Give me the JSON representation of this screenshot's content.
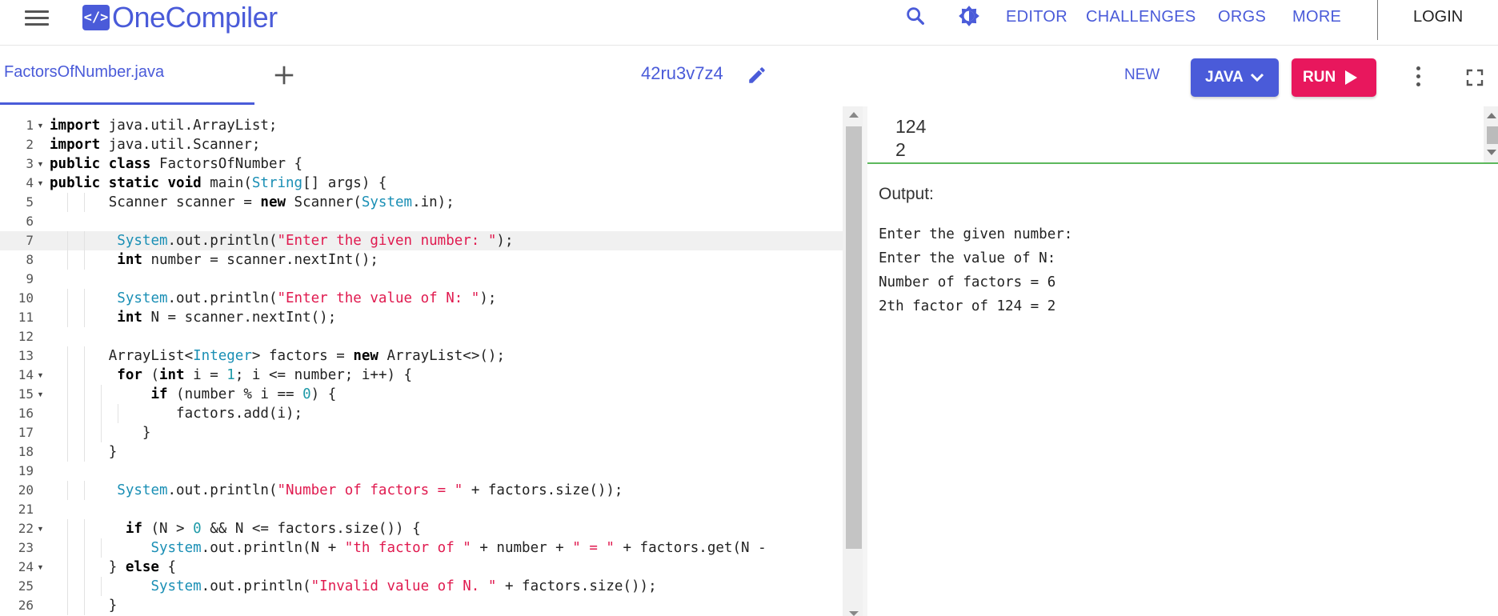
{
  "navbar": {
    "logo_badge": "</>",
    "logo_text": "OneCompiler",
    "links": [
      "EDITOR",
      "CHALLENGES",
      "ORGS",
      "MORE"
    ],
    "login": "LOGIN",
    "icons": [
      "menu-icon",
      "search-icon",
      "theme-toggle-icon"
    ]
  },
  "tabbar": {
    "file_tab": "FactorsOfNumber.java",
    "project_id": "42ru3v7z4",
    "new_label": "NEW",
    "language_label": "JAVA",
    "run_label": "RUN",
    "colors": {
      "accent": "#4a5bd9",
      "run": "#e8175d",
      "stdin_border": "#5cb85c"
    }
  },
  "editor": {
    "active_line": 7,
    "lines": [
      [
        [
          "kw",
          "import"
        ],
        [
          "",
          "  java.util.ArrayList;"
        ]
      ],
      [
        [
          "kw",
          "import"
        ],
        [
          "",
          "  java.util.Scanner;"
        ]
      ],
      [
        [
          "kw",
          "public class"
        ],
        [
          "",
          "  FactorsOfNumber {"
        ]
      ],
      [
        [
          "kw",
          "public static void"
        ],
        [
          "",
          "  main("
        ],
        [
          "ty",
          "String"
        ],
        [
          "",
          "[] args) {"
        ]
      ],
      [
        [
          "",
          "        Scanner scanner = "
        ],
        [
          "kw",
          "new"
        ],
        [
          "",
          "  Scanner("
        ],
        [
          "ty",
          "System"
        ],
        [
          "",
          ".in);"
        ]
      ],
      [
        [
          "",
          ""
        ]
      ],
      [
        [
          "",
          "        "
        ],
        [
          "ty",
          "System"
        ],
        [
          "",
          ".out.println("
        ],
        [
          "st",
          "\"Enter the given number: \""
        ],
        [
          "",
          ");"
        ]
      ],
      [
        [
          "",
          "        "
        ],
        [
          "kw",
          "int"
        ],
        [
          "",
          "  number = scanner.nextInt();"
        ]
      ],
      [
        [
          "",
          ""
        ]
      ],
      [
        [
          "",
          "        "
        ],
        [
          "ty",
          "System"
        ],
        [
          "",
          ".out.println("
        ],
        [
          "st",
          "\"Enter the value of N: \""
        ],
        [
          "",
          ");"
        ]
      ],
      [
        [
          "",
          "        "
        ],
        [
          "kw",
          "int"
        ],
        [
          "",
          "  N = scanner.nextInt();"
        ]
      ],
      [
        [
          "",
          ""
        ]
      ],
      [
        [
          "",
          "        ArrayList<"
        ],
        [
          "ty",
          "Integer"
        ],
        [
          "",
          "> factors = "
        ],
        [
          "kw",
          "new"
        ],
        [
          "",
          "  ArrayList<>();"
        ]
      ],
      [
        [
          "",
          "        "
        ],
        [
          "kw",
          "for"
        ],
        [
          "",
          "  ("
        ],
        [
          "kw",
          "int"
        ],
        [
          "",
          "  i = "
        ],
        [
          "nm",
          "1"
        ],
        [
          "",
          "; i <= number; i++) {"
        ]
      ],
      [
        [
          "",
          "            "
        ],
        [
          "kw",
          "if"
        ],
        [
          "",
          "  (number % i == "
        ],
        [
          "nm",
          "0"
        ],
        [
          "",
          ") {"
        ]
      ],
      [
        [
          "",
          "                factors.add(i);"
        ]
      ],
      [
        [
          "",
          "            }"
        ]
      ],
      [
        [
          "",
          "        }"
        ]
      ],
      [
        [
          "",
          ""
        ]
      ],
      [
        [
          "",
          "        "
        ],
        [
          "ty",
          "System"
        ],
        [
          "",
          ".out.println("
        ],
        [
          "st",
          "\"Number of factors = \""
        ],
        [
          "",
          "  + factors.size());"
        ]
      ],
      [
        [
          "",
          ""
        ]
      ],
      [
        [
          "",
          "         "
        ],
        [
          "kw",
          "if"
        ],
        [
          "",
          "  (N > "
        ],
        [
          "nm",
          "0"
        ],
        [
          "",
          "  && N <= factors.size()) {"
        ]
      ],
      [
        [
          "",
          "            "
        ],
        [
          "ty",
          "System"
        ],
        [
          "",
          ".out.println(N + "
        ],
        [
          "st",
          "\"th factor of \""
        ],
        [
          "",
          "  + number + "
        ],
        [
          "st",
          "\" = \""
        ],
        [
          "",
          "  + factors.get(N -"
        ]
      ],
      [
        [
          "",
          "        } "
        ],
        [
          "kw",
          "else"
        ],
        [
          "",
          " {"
        ]
      ],
      [
        [
          "",
          "            "
        ],
        [
          "ty",
          "System"
        ],
        [
          "",
          ".out.println("
        ],
        [
          "st",
          "\"Invalid value of N. \""
        ],
        [
          "",
          "  + factors.size());"
        ]
      ],
      [
        [
          "",
          "        }"
        ]
      ],
      [
        [
          "",
          ""
        ]
      ]
    ]
  },
  "stdin": {
    "lines": [
      "124",
      "2"
    ]
  },
  "output": {
    "title": "Output:",
    "lines": [
      "Enter the given number:",
      "Enter the value of N:",
      "Number of factors = 6",
      "2th factor of 124 = 2"
    ]
  }
}
